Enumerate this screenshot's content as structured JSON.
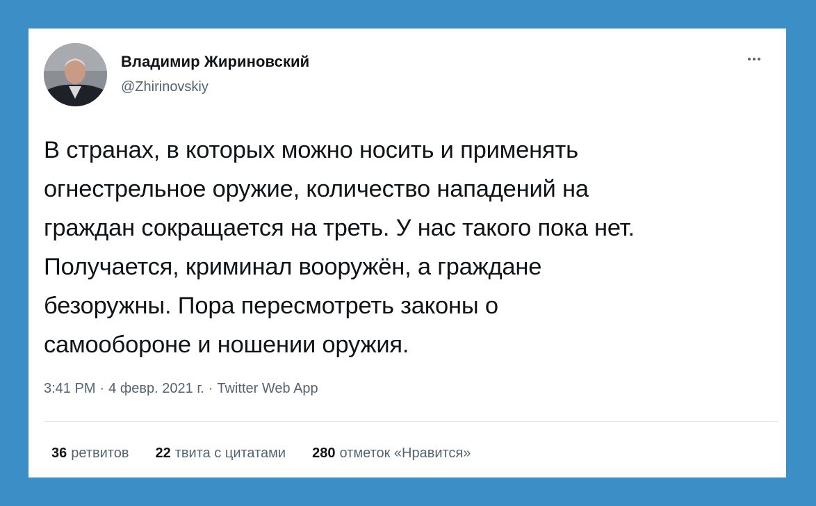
{
  "author": {
    "display_name": "Владимир Жириновский",
    "handle": "@Zhirinovskiy",
    "avatar_icon": "profile-photo"
  },
  "more_icon": "ellipsis-icon",
  "tweet": {
    "text": "В странах, в которых можно носить и применять\nогнестрельное оружие, количество нападений на\nграждан сокращается на треть. У нас такого пока нет.\nПолучается, криминал вооружён, а граждане\nбезоружны. Пора пересмотреть законы о\nсамообороне и ношении оружия."
  },
  "meta": {
    "time": "3:41 PM",
    "separator": "·",
    "date": "4 февр. 2021 г.",
    "app": "Twitter Web App"
  },
  "stats": {
    "retweets": {
      "count": "36",
      "label": "ретвитов"
    },
    "quotes": {
      "count": "22",
      "label": "твита с цитатами"
    },
    "likes": {
      "count": "280",
      "label": "отметок «Нравится»"
    }
  },
  "colors": {
    "background": "#3b8fc6",
    "card": "#ffffff",
    "text": "#0f1419",
    "secondary": "#536471"
  }
}
